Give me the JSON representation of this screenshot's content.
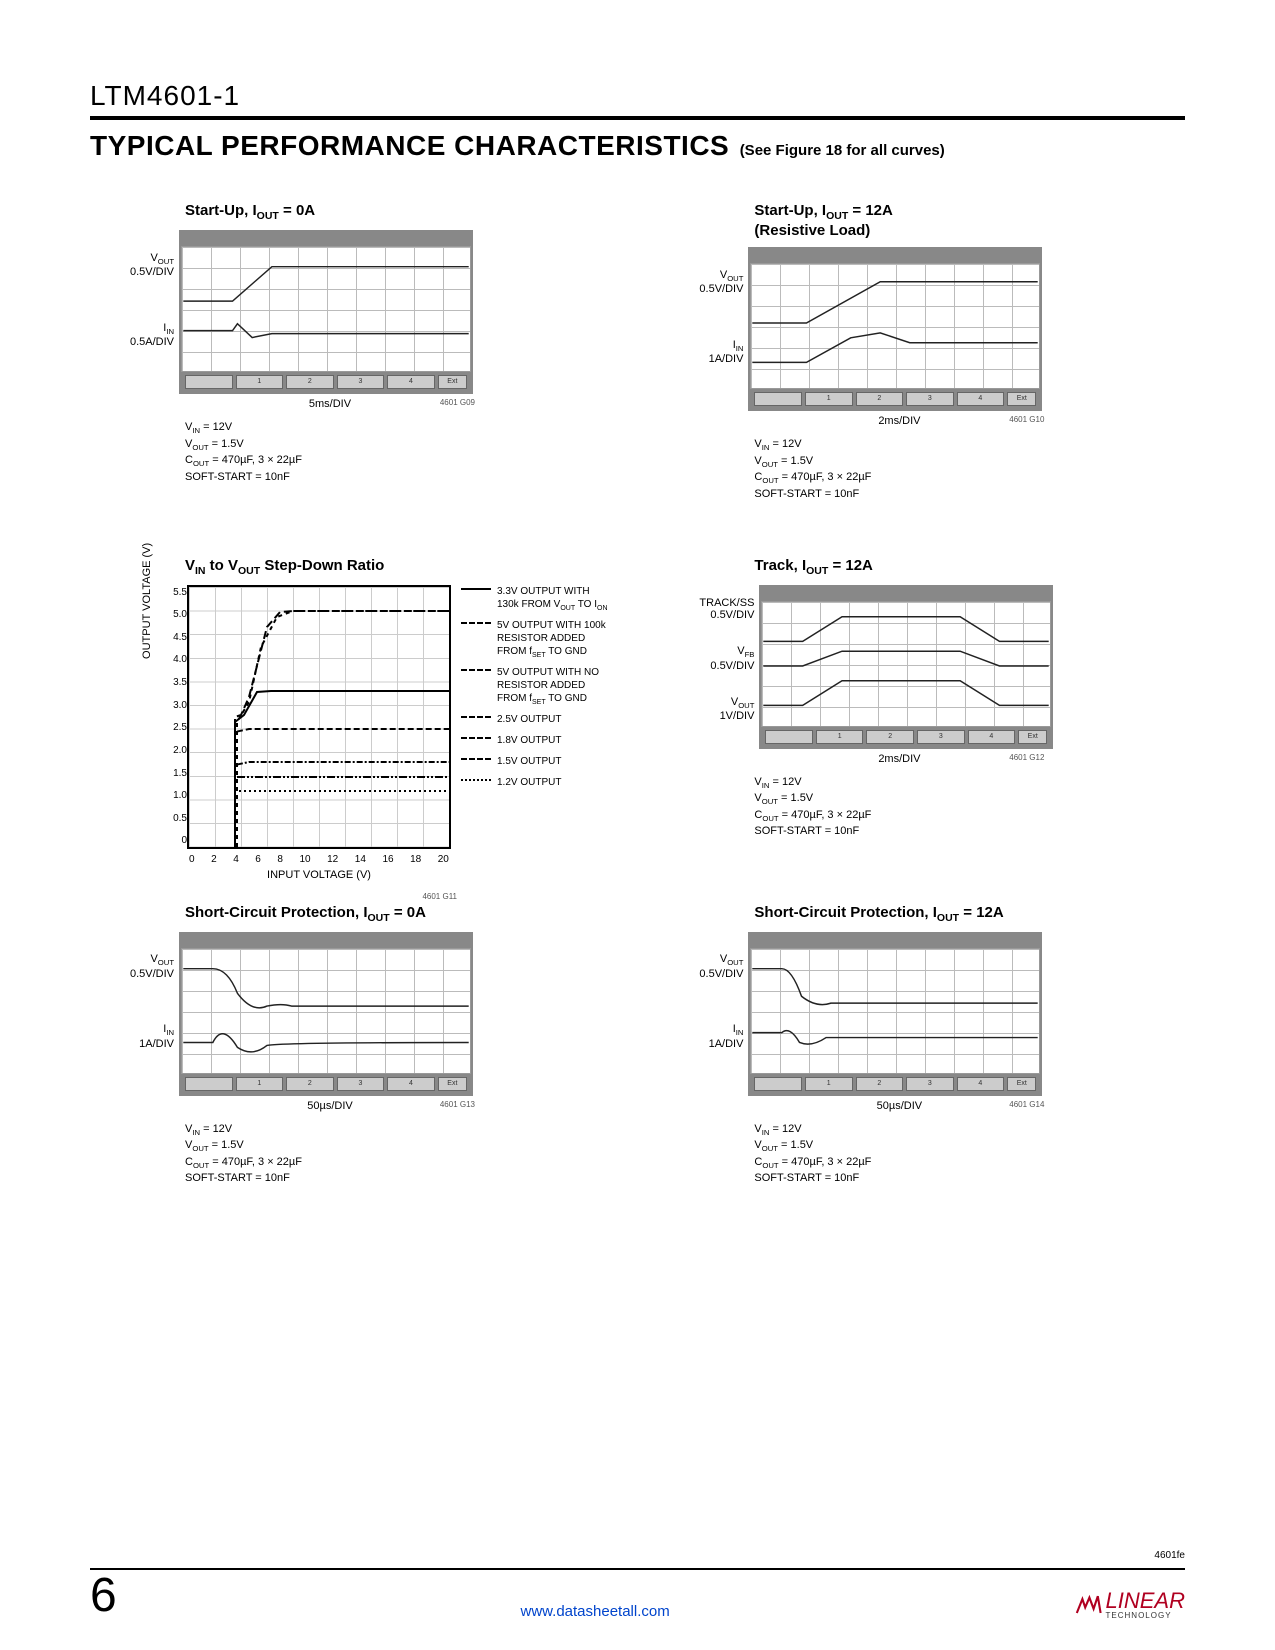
{
  "part_number": "LTM4601-1",
  "section_title": "TYPICAL PERFORMANCE CHARACTERISTICS",
  "section_note": "(See Figure 18 for all curves)",
  "doc_rev": "4601fe",
  "page_number": "6",
  "footer_url": "www.datasheetall.com",
  "logo_text": "LINEAR",
  "logo_sub": "TECHNOLOGY",
  "common_conditions": {
    "vin": "VIN = 12V",
    "vout": "VOUT = 1.5V",
    "cout": "COUT = 470µF, 3 × 22µF",
    "ss": "SOFT-START = 10nF"
  },
  "charts": [
    {
      "key": "startup0",
      "title": "Start-Up, IOUT = 0A",
      "ych": [
        "VOUT\n0.5V/DIV",
        "IIN\n0.5A/DIV"
      ],
      "xlabel": "5ms/DIV",
      "figid": "4601 G09"
    },
    {
      "key": "startup12",
      "title": "Start-Up, IOUT = 12A\n(Resistive Load)",
      "ych": [
        "VOUT\n0.5V/DIV",
        "IIN\n1A/DIV"
      ],
      "xlabel": "2ms/DIV",
      "figid": "4601 G10"
    },
    {
      "key": "stepdown",
      "title": "VIN to VOUT Step-Down Ratio",
      "xlabel": "INPUT VOLTAGE (V)",
      "ylabel": "OUTPUT VOLTAGE (V)",
      "figid": "4601 G11",
      "yticks": [
        "5.5",
        "5.0",
        "4.5",
        "4.0",
        "3.5",
        "3.0",
        "2.5",
        "2.0",
        "1.5",
        "1.0",
        "0.5",
        "0"
      ],
      "xticks": [
        "0",
        "2",
        "4",
        "6",
        "8",
        "10",
        "12",
        "14",
        "16",
        "18",
        "20"
      ],
      "legend": [
        "3.3V OUTPUT WITH 130k FROM VOUT TO ION",
        "5V OUTPUT WITH 100k RESISTOR ADDED FROM fSET TO GND",
        "5V OUTPUT WITH NO RESISTOR ADDED FROM fSET TO GND",
        "2.5V OUTPUT",
        "1.8V OUTPUT",
        "1.5V OUTPUT",
        "1.2V OUTPUT"
      ]
    },
    {
      "key": "track",
      "title": "Track, IOUT = 12A",
      "ych": [
        "TRACK/SS\n0.5V/DIV",
        "VFB\n0.5V/DIV",
        "VOUT\n1V/DIV"
      ],
      "xlabel": "2ms/DIV",
      "figid": "4601 G12"
    },
    {
      "key": "sc0",
      "title": "Short-Circuit Protection, IOUT = 0A",
      "ych": [
        "VOUT\n0.5V/DIV",
        "IIN\n1A/DIV"
      ],
      "xlabel": "50µs/DIV",
      "figid": "4601 G13"
    },
    {
      "key": "sc12",
      "title": "Short-Circuit Protection, IOUT = 12A",
      "ych": [
        "VOUT\n0.5V/DIV",
        "IIN\n1A/DIV"
      ],
      "xlabel": "50µs/DIV",
      "figid": "4601 G14"
    }
  ],
  "chart_data": [
    {
      "type": "line",
      "title": "VIN to VOUT Step-Down Ratio",
      "xlabel": "INPUT VOLTAGE (V)",
      "ylabel": "OUTPUT VOLTAGE (V)",
      "xlim": [
        0,
        20
      ],
      "ylim": [
        0,
        5.5
      ],
      "x": [
        0,
        2,
        3,
        4,
        5,
        6,
        7,
        8,
        10,
        12,
        14,
        16,
        18,
        20
      ],
      "series": [
        {
          "name": "3.3V OUTPUT WITH 130k FROM VOUT TO ION",
          "values": [
            0,
            0,
            0,
            2.8,
            3.2,
            3.3,
            3.3,
            3.3,
            3.3,
            3.3,
            3.3,
            3.3,
            3.3,
            3.3
          ]
        },
        {
          "name": "5V OUTPUT WITH 100k RESISTOR ADDED FROM fSET TO GND",
          "values": [
            0,
            0,
            0,
            2.5,
            3.5,
            4.6,
            4.95,
            5.0,
            5.0,
            5.0,
            5.0,
            5.0,
            5.0,
            5.0
          ]
        },
        {
          "name": "5V OUTPUT WITH NO RESISTOR ADDED FROM fSET TO GND",
          "values": [
            0,
            0,
            0,
            2.5,
            3.2,
            4.2,
            4.8,
            5.0,
            5.0,
            5.0,
            5.0,
            5.0,
            5.0,
            5.0
          ]
        },
        {
          "name": "2.5V OUTPUT",
          "values": [
            0,
            0,
            0,
            2.4,
            2.5,
            2.5,
            2.5,
            2.5,
            2.5,
            2.5,
            2.5,
            2.5,
            2.5,
            2.5
          ]
        },
        {
          "name": "1.8V OUTPUT",
          "values": [
            0,
            0,
            0,
            1.75,
            1.8,
            1.8,
            1.8,
            1.8,
            1.8,
            1.8,
            1.8,
            1.8,
            1.8,
            1.8
          ]
        },
        {
          "name": "1.5V OUTPUT",
          "values": [
            0,
            0,
            0,
            1.5,
            1.5,
            1.5,
            1.5,
            1.5,
            1.5,
            1.5,
            1.5,
            1.5,
            1.5,
            1.5
          ]
        },
        {
          "name": "1.2V OUTPUT",
          "values": [
            0,
            0,
            0,
            1.2,
            1.2,
            1.2,
            1.2,
            1.2,
            1.2,
            1.2,
            1.2,
            1.2,
            1.2,
            1.2
          ]
        }
      ]
    }
  ]
}
